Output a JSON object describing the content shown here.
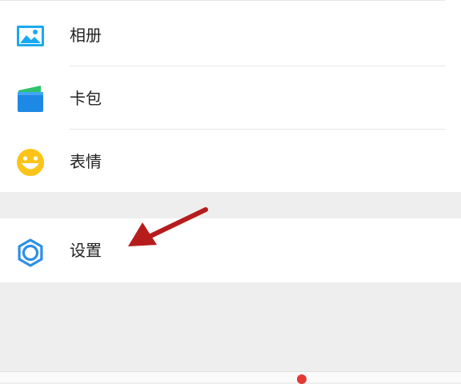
{
  "menu": {
    "album_label": "相册",
    "cards_label": "卡包",
    "stickers_label": "表情",
    "settings_label": "设置"
  },
  "colors": {
    "album_icon": "#1aa9f0",
    "cards_icon": "#1e88e5",
    "cards_icon_accent": "#2ec46b",
    "stickers_icon": "#fcc419",
    "settings_icon": "#2d8fe6",
    "arrow": "#b71c1c",
    "badge": "#e53935"
  }
}
